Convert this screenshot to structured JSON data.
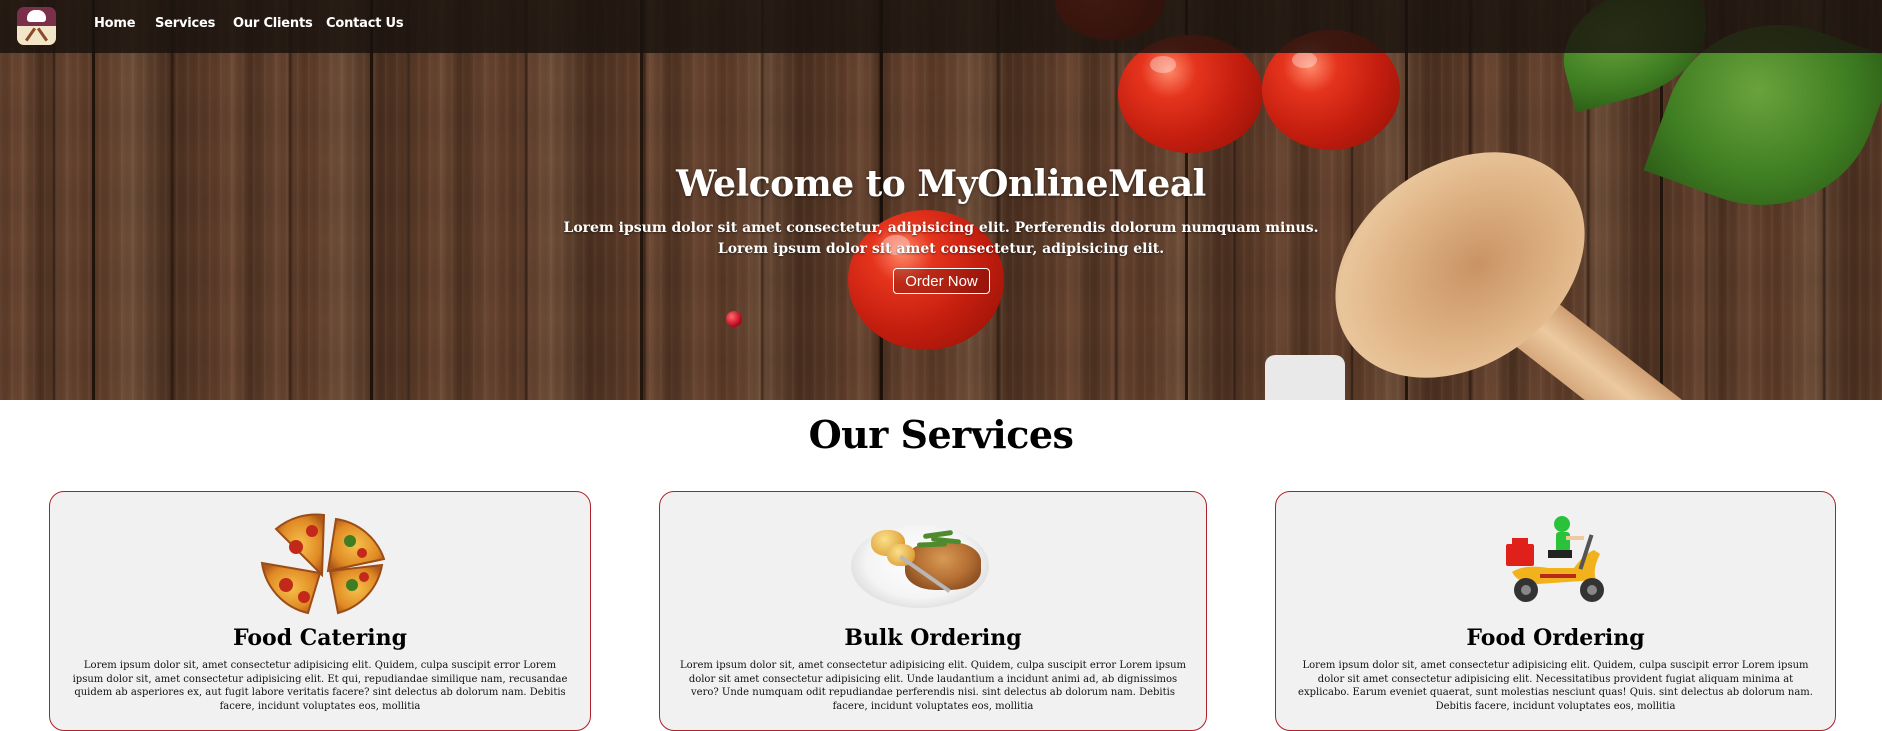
{
  "nav": {
    "logo_alt": "MyOnlineMeal logo",
    "links": [
      "Home",
      "Services",
      "Our Clients",
      "Contact Us"
    ]
  },
  "hero": {
    "title": "Welcome to MyOnlineMeal",
    "subtitle_line1": "Lorem ipsum dolor sit amet consectetur, adipisicing elit. Perferendis dolorum numquam minus.",
    "subtitle_line2": "Lorem ipsum dolor sit amet consectetur, adipisicing elit.",
    "button_label": "Order Now"
  },
  "services": {
    "heading": "Our Services",
    "cards": [
      {
        "title": "Food Catering",
        "icon": "pizza-icon",
        "text": "Lorem ipsum dolor sit, amet consectetur adipisicing elit. Quidem, culpa suscipit error Lorem ipsum dolor sit, amet consectetur adipisicing elit. Et qui, repudiandae similique nam, recusandae quidem ab asperiores ex, aut fugit labore veritatis facere? sint delectus ab dolorum nam. Debitis facere, incidunt voluptates eos, mollitia"
      },
      {
        "title": "Bulk Ordering",
        "icon": "meal-plate-icon",
        "text": "Lorem ipsum dolor sit, amet consectetur adipisicing elit. Quidem, culpa suscipit error Lorem ipsum dolor sit amet consectetur adipisicing elit. Unde laudantium a incidunt animi ad, ab dignissimos vero? Unde numquam odit repudiandae perferendis nisi. sint delectus ab dolorum nam. Debitis facere, incidunt voluptates eos, mollitia"
      },
      {
        "title": "Food Ordering",
        "icon": "delivery-scooter-icon",
        "text": "Lorem ipsum dolor sit, amet consectetur adipisicing elit. Quidem, culpa suscipit error Lorem ipsum dolor sit amet consectetur adipisicing elit. Necessitatibus provident fugiat aliquam minima at explicabo. Earum eveniet quaerat, sunt molestias nesciunt quas! Quis. sint delectus ab dolorum nam. Debitis facere, incidunt voluptates eos, mollitia"
      }
    ]
  },
  "colors": {
    "nav_bg": "#19120e",
    "card_border": "#b0202a",
    "card_bg": "#f1f1f1"
  }
}
